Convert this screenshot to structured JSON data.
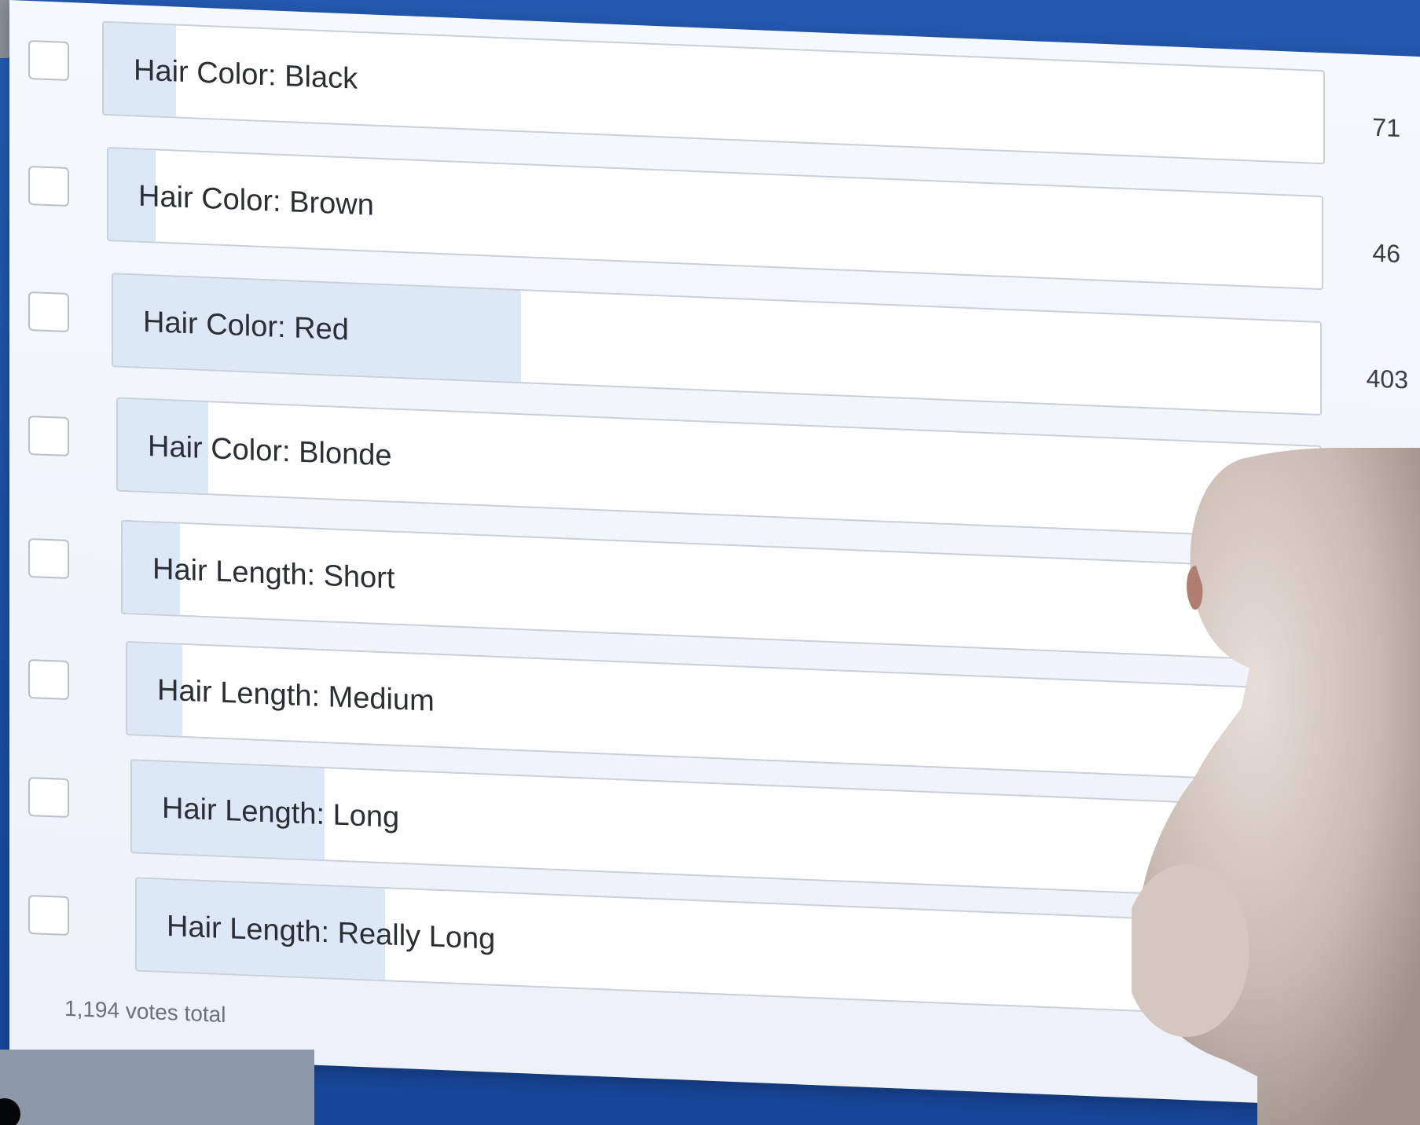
{
  "poll": {
    "options": [
      {
        "label": "Hair Color: Black",
        "votes": "71",
        "share": 0.059
      },
      {
        "label": "Hair Color: Brown",
        "votes": "46",
        "share": 0.039
      },
      {
        "label": "Hair Color: Red",
        "votes": "403",
        "share": 0.338
      },
      {
        "label": "Hair Color: Blonde",
        "votes": "",
        "share": 0.075
      },
      {
        "label": "Hair Length: Short",
        "votes": "",
        "share": 0.048
      },
      {
        "label": "Hair Length: Medium",
        "votes": "",
        "share": 0.046
      },
      {
        "label": "Hair Length: Long",
        "votes": "",
        "share": 0.162
      },
      {
        "label": "Hair Length: Really Long",
        "votes": "",
        "share": 0.21
      }
    ],
    "total_text": "1,194 votes total"
  },
  "colors": {
    "background": "#1b4fa0",
    "panel": "#f5f8fd",
    "bar_fill": "#dce8f6",
    "bar_border": "#c9d0d9"
  },
  "icons": {
    "checkbox": "empty-square-checkbox"
  }
}
